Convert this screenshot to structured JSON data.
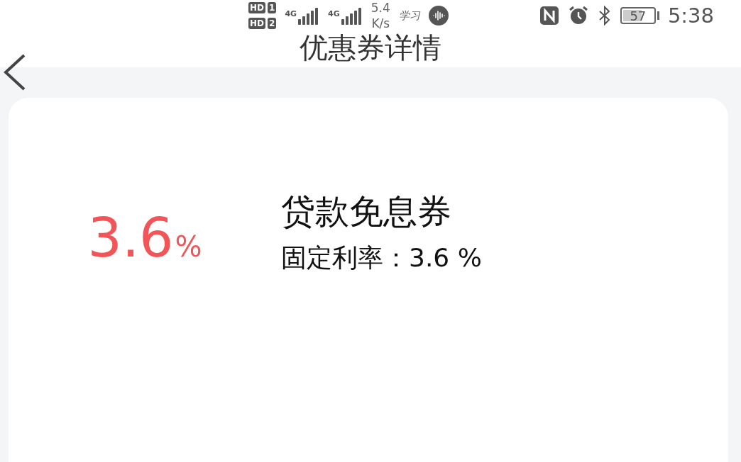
{
  "status_bar": {
    "sim_badges": [
      {
        "label": "HD",
        "slot": "1"
      },
      {
        "label": "HD",
        "slot": "2"
      }
    ],
    "networks": [
      {
        "label": "4G"
      },
      {
        "label": "4G"
      }
    ],
    "speed": {
      "value": "5.4",
      "unit": "K/s"
    },
    "app_label": "学习",
    "battery": {
      "text": "57",
      "level": 0.57
    },
    "time": "5:38"
  },
  "header": {
    "title": "优惠券详情"
  },
  "coupon": {
    "amount": "3.6",
    "unit": "%",
    "name": "贷款免息券",
    "detail": "固定利率：3.6 %"
  }
}
